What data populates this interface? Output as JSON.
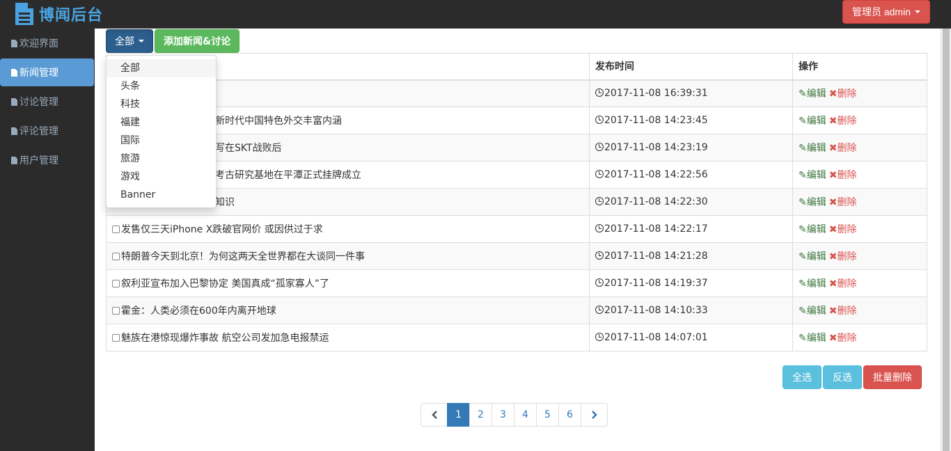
{
  "header": {
    "logo_text": "博闻后台",
    "admin_label": "管理员 admin"
  },
  "sidebar": {
    "items": [
      {
        "label": "欢迎界面",
        "active": false
      },
      {
        "label": "新闻管理",
        "active": true
      },
      {
        "label": "讨论管理",
        "active": false
      },
      {
        "label": "评论管理",
        "active": false
      },
      {
        "label": "用户管理",
        "active": false
      }
    ]
  },
  "toolbar": {
    "filter_label": "全部",
    "add_label": "添加新闻&讨论"
  },
  "dropdown": {
    "options": [
      "全部",
      "头条",
      "科技",
      "福建",
      "国际",
      "旅游",
      "游戏",
      "Banner"
    ],
    "highlighted": "全部"
  },
  "table": {
    "headers": {
      "time": "发布时间",
      "ops": "操作"
    },
    "edit_label": "编辑",
    "delete_label": "删除",
    "rows": [
      {
        "title": "",
        "time": "2017-11-08 16:39:31"
      },
      {
        "title": "新时代中国特色外交丰富内涵",
        "time": "2017-11-08 14:23:45"
      },
      {
        "title": "写在SKT战败后",
        "time": "2017-11-08 14:23:19"
      },
      {
        "title": "考古研究基地在平潭正式挂牌成立",
        "time": "2017-11-08 14:22:56"
      },
      {
        "title": "知识",
        "time": "2017-11-08 14:22:30"
      },
      {
        "title": "发售仅三天iPhone X跌破官网价 或因供过于求",
        "time": "2017-11-08 14:22:17"
      },
      {
        "title": "特朗普今天到北京！为何这两天全世界都在大谈同一件事",
        "time": "2017-11-08 14:21:28"
      },
      {
        "title": "叙利亚宣布加入巴黎协定 美国真成“孤家寡人”了",
        "time": "2017-11-08 14:19:37"
      },
      {
        "title": "霍金：人类必须在600年内离开地球",
        "time": "2017-11-08 14:10:33"
      },
      {
        "title": "魅族在港惊现爆炸事故 航空公司发加急电报禁运",
        "time": "2017-11-08 14:07:01"
      }
    ]
  },
  "actions": {
    "select_all": "全选",
    "invert": "反选",
    "batch_delete": "批量删除"
  },
  "pagination": {
    "pages": [
      "1",
      "2",
      "3",
      "4",
      "5",
      "6"
    ],
    "current": "1"
  }
}
